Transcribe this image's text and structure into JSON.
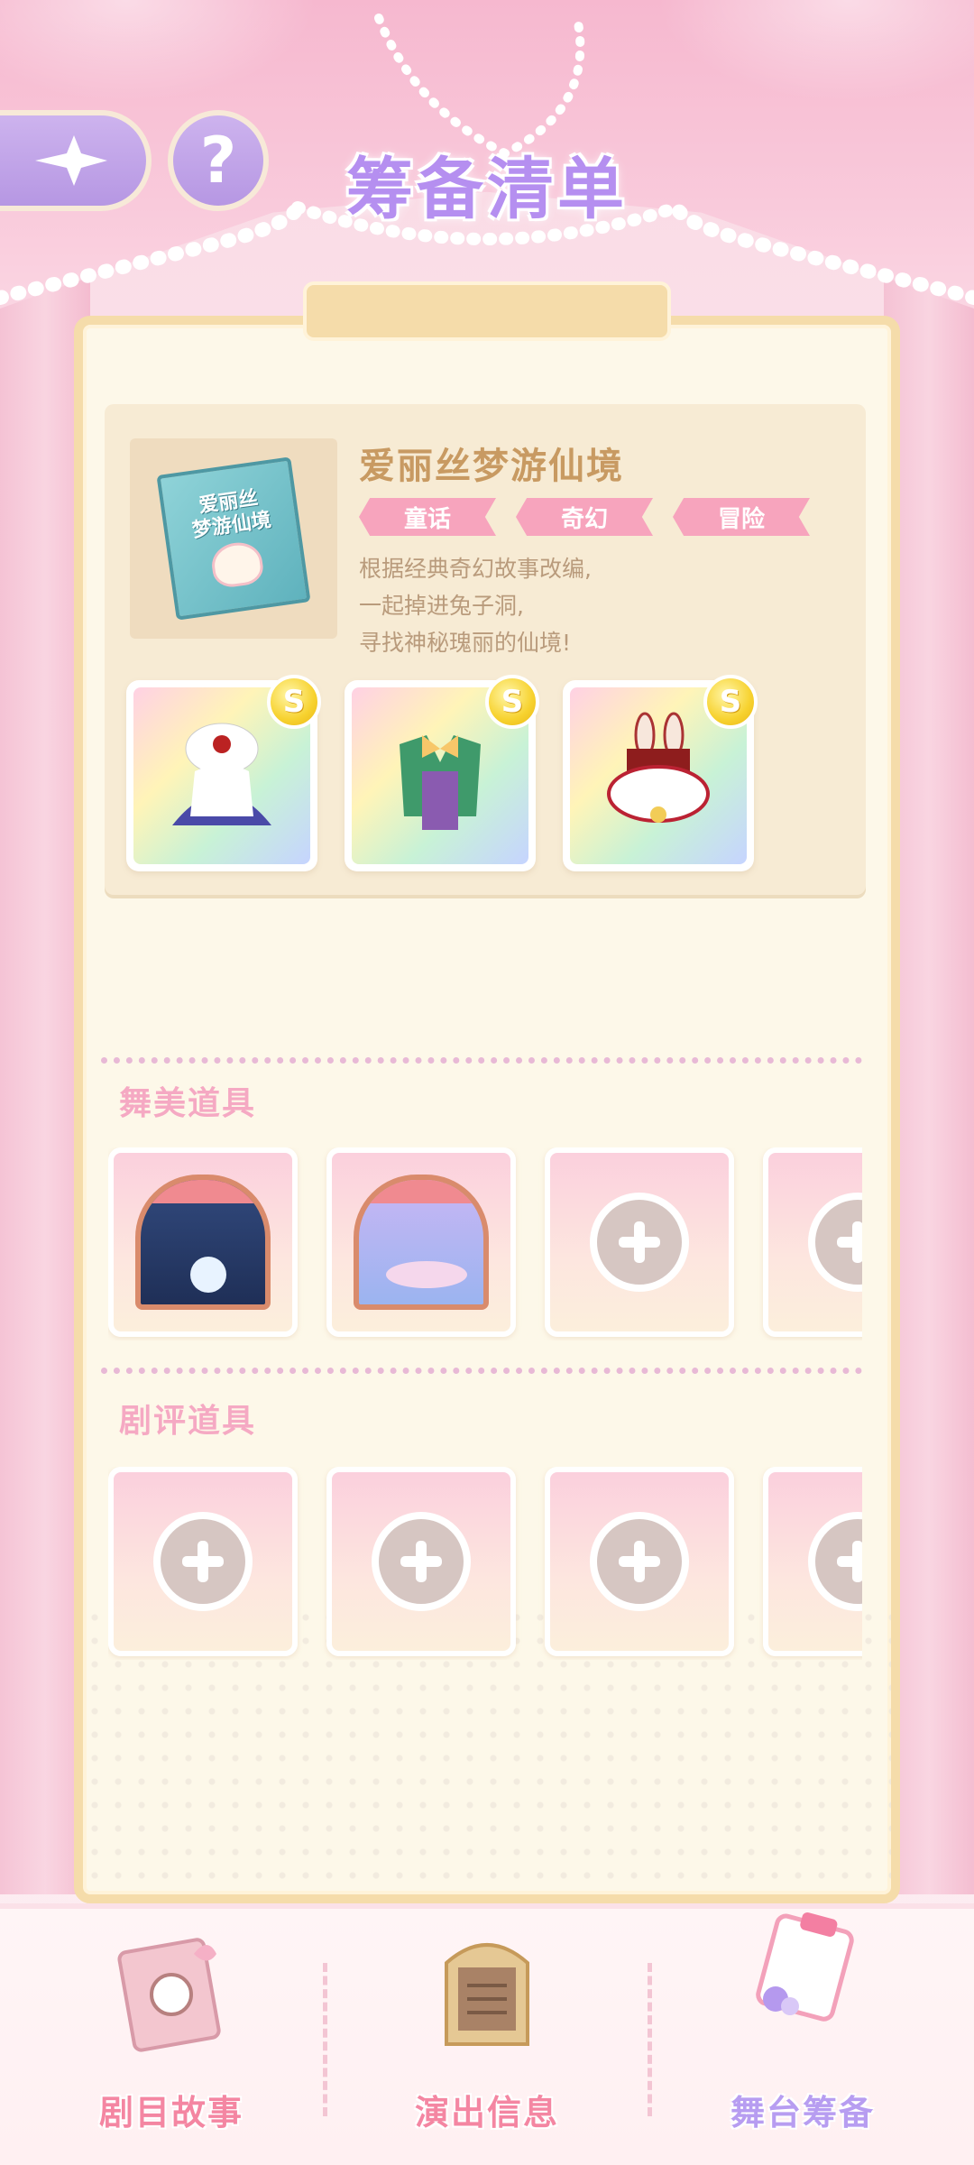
{
  "header": {
    "title": "筹备清单",
    "back_icon": "sparkle-back-icon",
    "help_label": "?"
  },
  "story": {
    "book_title_line1": "爱丽丝",
    "book_title_line2": "梦游仙境",
    "title": "爱丽丝梦游仙境",
    "tags": [
      "童话",
      "奇幻",
      "冒险"
    ],
    "description": [
      "根据经典奇幻故事改编,",
      "一起掉进兔子洞,",
      "寻找神秘瑰丽的仙境!"
    ],
    "outfits": [
      {
        "name": "blue-dress-outfit",
        "badge": "S"
      },
      {
        "name": "green-suit-outfit",
        "badge": "S"
      },
      {
        "name": "bunny-hat-outfit",
        "badge": "S"
      }
    ]
  },
  "sections": {
    "stage_props_label": "舞美道具",
    "review_props_label": "剧评道具"
  },
  "bottom_nav": {
    "items": [
      {
        "label": "剧目故事",
        "active": false
      },
      {
        "label": "演出信息",
        "active": false
      },
      {
        "label": "舞台筹备",
        "active": true
      }
    ]
  },
  "colors": {
    "title_purple": "#b58ff0",
    "tag_pink": "#f7a4bd",
    "section_pink": "#f5a9c3",
    "coin_gold": "#f7d22f",
    "panel_cream": "#fdf8e9"
  }
}
